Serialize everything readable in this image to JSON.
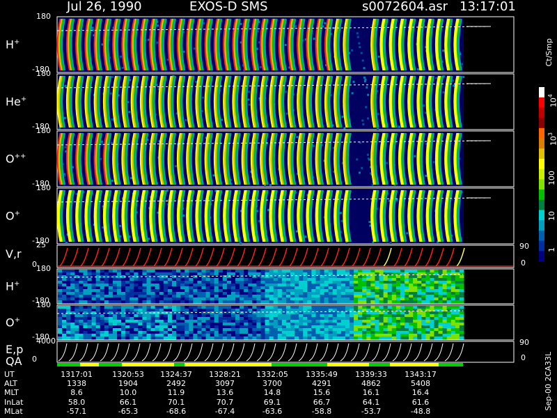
{
  "header": {
    "date": "Jul 26, 1990",
    "instrument": "EXOS-D SMS",
    "file": "s0072604.asr",
    "time": "13:17:01"
  },
  "panels": [
    {
      "id": "hplus",
      "label": "H",
      "sup": "+",
      "ymax": "180",
      "ymin": "-180"
    },
    {
      "id": "heplus",
      "label": "He",
      "sup": "+",
      "ymax": "180",
      "ymin": "-180"
    },
    {
      "id": "oplusplus",
      "label": "O",
      "sup": "++",
      "ymax": "180",
      "ymin": "-180"
    },
    {
      "id": "oplus",
      "label": "O",
      "sup": "+",
      "ymax": "180",
      "ymin": "-180"
    },
    {
      "id": "vr",
      "label": "V,r",
      "sup": "",
      "ymax": "25",
      "ymin": "0",
      "rmax": "90",
      "rmin": "0"
    },
    {
      "id": "hplus2",
      "label": "H",
      "sup": "+",
      "ymax": "180",
      "ymin": "-180"
    },
    {
      "id": "oplus2",
      "label": "O",
      "sup": "+",
      "ymax": "180",
      "ymin": "-180"
    },
    {
      "id": "ep",
      "label": "E,p",
      "sup": "",
      "ymax": "4000",
      "ymin": "0",
      "rmax": "90",
      "rmin": "0"
    }
  ],
  "qa_label": "QA",
  "colorbar": {
    "unit": "Ct/Smp",
    "labels": [
      {
        "text": "10",
        "sup": "4",
        "pos": 0.08
      },
      {
        "text": "10",
        "sup": "3",
        "pos": 0.3
      },
      {
        "text": "100",
        "sup": "",
        "pos": 0.52
      },
      {
        "text": "10",
        "sup": "",
        "pos": 0.75
      },
      {
        "text": "1",
        "sup": "",
        "pos": 0.96
      }
    ],
    "colors": [
      "#ffffff",
      "#ff0000",
      "#c00000",
      "#8b0000",
      "#ff6600",
      "#d98000",
      "#e0c000",
      "#ffff00",
      "#c8f000",
      "#80e000",
      "#00c000",
      "#008040",
      "#00d0d0",
      "#00a0c0",
      "#0060b0",
      "#0030a0",
      "#000080"
    ]
  },
  "footer": {
    "rows": [
      {
        "name": "UT",
        "values": [
          "1317:01",
          "1320:53",
          "1324:37",
          "1328:21",
          "1332:05",
          "1335:49",
          "1339:33",
          "1343:17"
        ]
      },
      {
        "name": "ALT",
        "values": [
          "1338",
          "1904",
          "2492",
          "3097",
          "3700",
          "4291",
          "4862",
          "5408"
        ]
      },
      {
        "name": "MLT",
        "values": [
          "8.6",
          "10.0",
          "11.9",
          "13.6",
          "14.8",
          "15.6",
          "16.1",
          "16.4"
        ]
      },
      {
        "name": "InLat",
        "values": [
          "58.0",
          "66.1",
          "70.1",
          "70.7",
          "69.1",
          "66.7",
          "64.1",
          "61.6"
        ]
      },
      {
        "name": "MLat",
        "values": [
          "-57.1",
          "-65.3",
          "-68.6",
          "-67.4",
          "-63.6",
          "-58.8",
          "-53.7",
          "-48.8"
        ]
      }
    ],
    "side_text": "Sep-00 2CA33L"
  },
  "chart_data": {
    "type": "heatmap",
    "x": [
      "1317:01",
      "1320:53",
      "1324:37",
      "1328:21",
      "1332:05",
      "1335:49",
      "1339:33",
      "1343:17"
    ],
    "panels": [
      "H+",
      "He+",
      "O++",
      "O+",
      "V,r",
      "H+",
      "O+",
      "E,p"
    ],
    "pitch_angle_range": [
      -180,
      180
    ],
    "vr_range": [
      0,
      25
    ],
    "ep_range": [
      0,
      4000
    ],
    "right_axis_range": [
      0,
      90
    ],
    "colorbar_label": "Ct/Smp",
    "colorbar_ticks": [
      "1",
      "10",
      "100",
      "10^3",
      "10^4"
    ],
    "colorbar_scale": "log"
  },
  "colors": {
    "background": "#000000",
    "plot_bg": "#000060",
    "axis": "#ffffff",
    "trace_red": "#ff2020",
    "trace_yellow": "#ffff60",
    "qa_green": "#00d000",
    "qa_yellow": "#ffff00"
  }
}
